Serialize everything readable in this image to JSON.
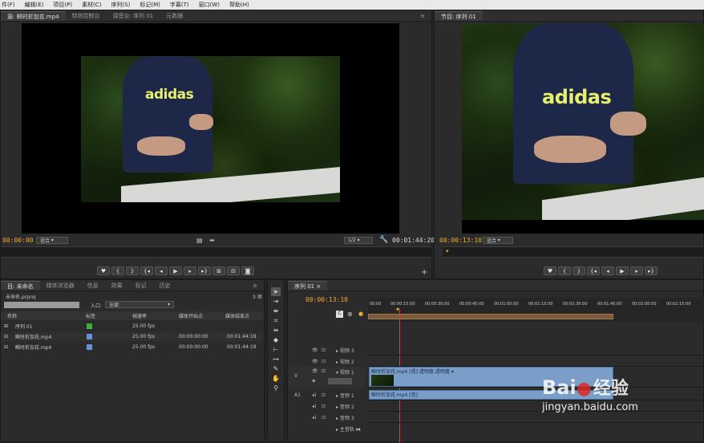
{
  "menu": [
    "件(F)",
    "编辑(E)",
    "项目(P)",
    "素材(C)",
    "序列(S)",
    "标记(M)",
    "字幕(T)",
    "窗口(W)",
    "帮助(H)"
  ],
  "source_monitor": {
    "tabs": [
      "源: 瞬时折加花.mp4",
      "特效控制台",
      "调音台: 序列 01",
      "元数据"
    ],
    "timecode_left": "00:00:00",
    "zoom": "适合",
    "resolution": "1/2",
    "timecode_right": "00:01:44:20"
  },
  "program_monitor": {
    "tab": "节目: 序列 01",
    "timecode_left": "00:00:13:10",
    "zoom": "适合"
  },
  "video_logo": "adidas",
  "project": {
    "tabs": [
      "目: 未命名",
      "媒体浏览器",
      "信息",
      "效果",
      "标记",
      "历史"
    ],
    "file": "未命名.prproj",
    "count": "3 项",
    "inpoint_label": "入口:",
    "inpoint_value": "全部",
    "headers": [
      "名称",
      "标签",
      "帧速率",
      "媒体开始点",
      "媒体结束点"
    ],
    "rows": [
      {
        "name": "序列 01",
        "color": "#3cb043",
        "fps": "25.00 fps",
        "start": "",
        "end": ""
      },
      {
        "name": "瞬时折加花.mp4",
        "color": "#6a8fd8",
        "fps": "25.00 fps",
        "start": "00:00:00:00",
        "end": "00:01:44:19"
      },
      {
        "name": "瞬时折加花.mp4",
        "color": "#6a8fd8",
        "fps": "25.00 fps",
        "start": "00:00:00:00",
        "end": "00:01:44:19"
      }
    ]
  },
  "timeline": {
    "tab": "序列 01",
    "timecode": "00:00:13:10",
    "ruler": [
      "00:00",
      "00:00:15:00",
      "00:00:30:00",
      "00:00:45:00",
      "00:01:00:00",
      "00:01:15:00",
      "00:01:30:00",
      "00:01:45:00",
      "00:02:00:00",
      "00:02:15:00"
    ],
    "tracks": [
      {
        "label": "视频 3"
      },
      {
        "label": "视频 2"
      },
      {
        "label": "视频 1",
        "side": "V"
      },
      {
        "label": "音频 1",
        "side": "A1"
      },
      {
        "label": "音频 2"
      },
      {
        "label": "音频 3"
      },
      {
        "label": "主音轨"
      }
    ],
    "video_clip": "瞬时折加花.mp4 [视] 透明度:透明度 ▾",
    "audio_clip": "瞬时折加花.mp4 [音]"
  },
  "watermark": {
    "brand_a": "Bai",
    "brand_b": "经验",
    "url": "jingyan.baidu.com"
  },
  "colors": {
    "accent_timecode": "#f0a830",
    "clip_blue": "#7a9ec7",
    "playhead": "#d84040"
  }
}
